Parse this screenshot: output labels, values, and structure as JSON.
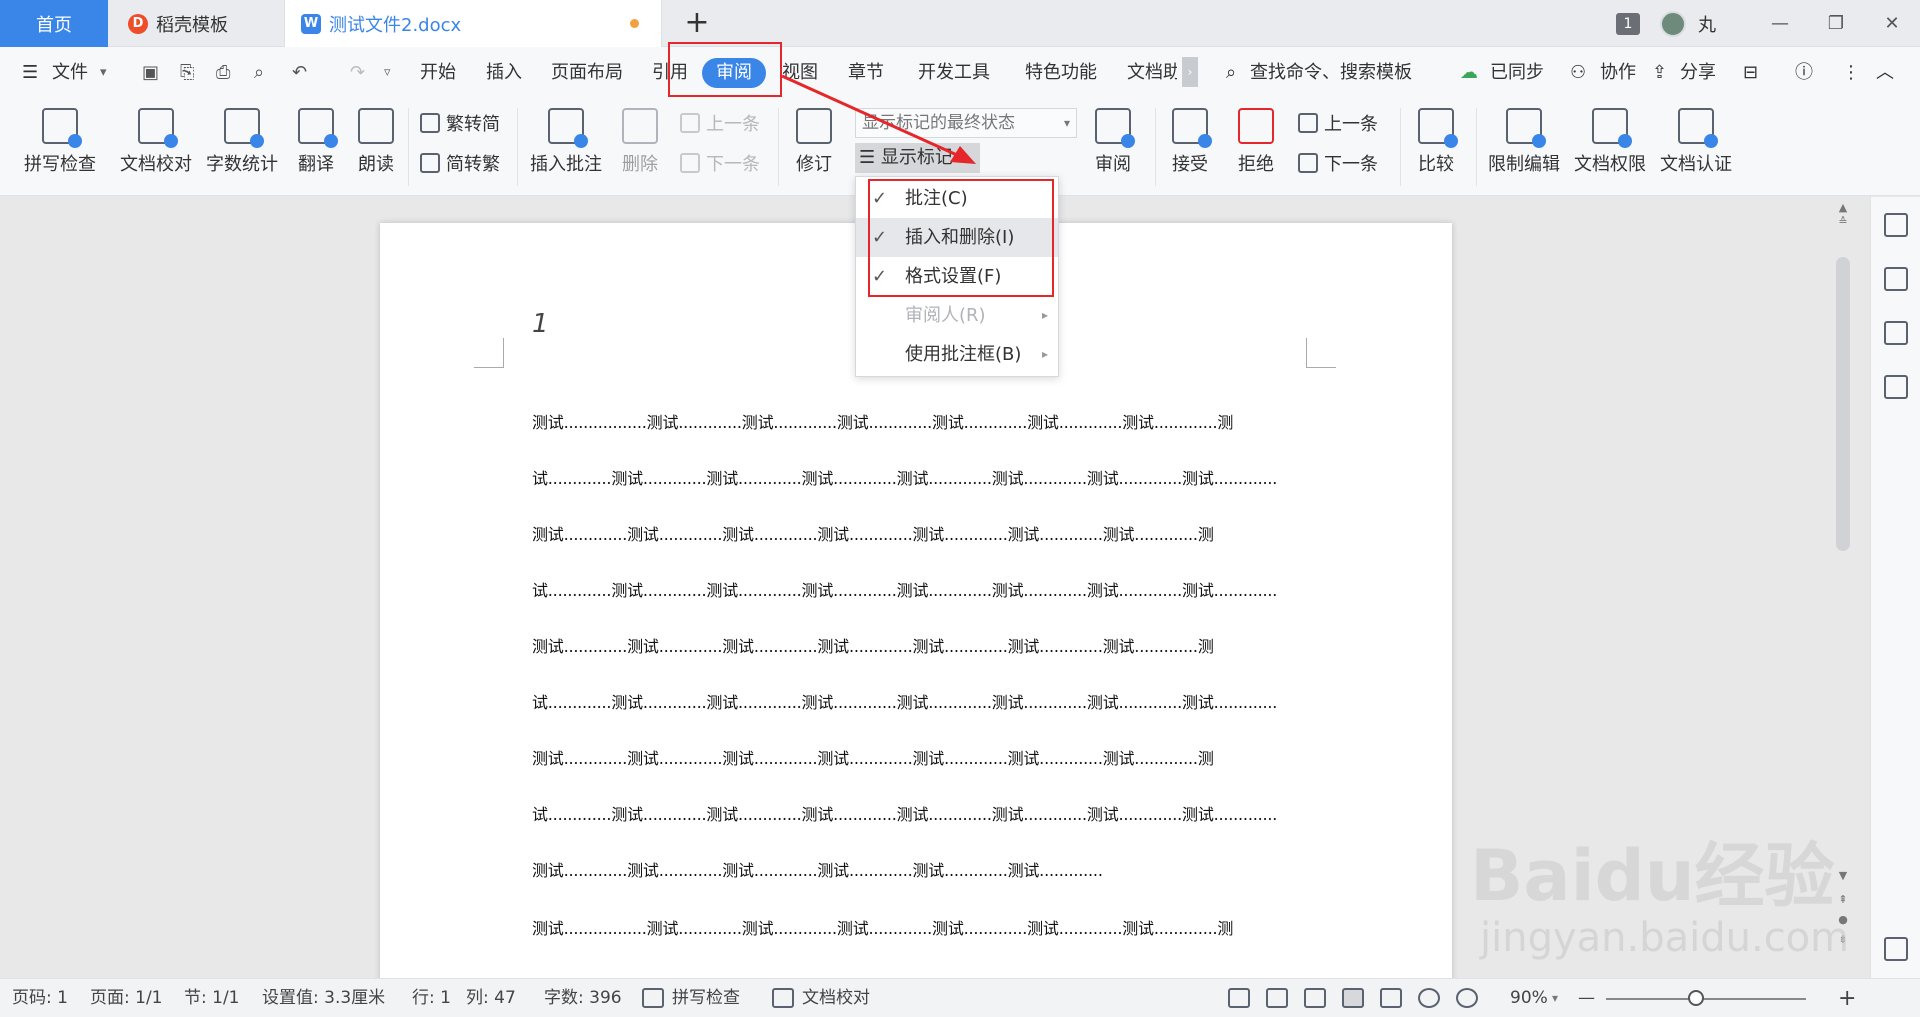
{
  "tabs": {
    "home": "首页",
    "daoke": "稻壳模板",
    "doc": "测试文件2.docx",
    "new_tab": "+"
  },
  "titlebar": {
    "window_count": "1",
    "username": "丸",
    "minimize": "—",
    "restore": "❐",
    "close": "✕"
  },
  "menu": {
    "file": "文件",
    "items": [
      "开始",
      "插入",
      "页面布局",
      "引用",
      "审阅",
      "视图",
      "章节",
      "开发工具",
      "特色功能",
      "文档助"
    ],
    "search": "查找命令、搜索模板",
    "synced": "已同步",
    "collab": "协作",
    "share": "分享"
  },
  "ribbon": {
    "spellcheck": "拼写检查",
    "proofread": "文档校对",
    "wordcount": "字数统计",
    "translate": "翻译",
    "read_aloud": "朗读",
    "trad_to_simp": "繁转简",
    "simp_to_trad": "简转繁",
    "insert_comment": "插入批注",
    "delete": "删除",
    "prev_comment": "上一条",
    "next_comment": "下一条",
    "track_changes": "修订",
    "markup_state": "显示标记的最终状态",
    "show_markup": "显示标记",
    "review": "审阅",
    "accept": "接受",
    "reject": "拒绝",
    "prev_change": "上一条",
    "next_change": "下一条",
    "compare": "比较",
    "restrict_edit": "限制编辑",
    "doc_permission": "文档权限",
    "doc_cert": "文档认证"
  },
  "dropdown": {
    "items": [
      {
        "label": "批注(C)",
        "checked": "✓"
      },
      {
        "label": "插入和删除(I)",
        "checked": "✓"
      },
      {
        "label": "格式设置(F)",
        "checked": "✓"
      },
      {
        "label": "审阅人(R)",
        "checked": ""
      },
      {
        "label": "使用批注框(B)",
        "checked": ""
      }
    ]
  },
  "document": {
    "page_number": "1",
    "lines": [
      "测试.................测试.............测试.............测试.............测试.............测试.............测试.............测",
      "试.............测试.............测试.............测试.............测试.............测试.............测试.............测试.............",
      "测试.............测试.............测试.............测试.............测试.............测试.............测试.............测",
      "试.............测试.............测试.............测试.............测试.............测试.............测试.............测试.............",
      "测试.............测试.............测试.............测试.............测试.............测试.............测试.............测",
      "试.............测试.............测试.............测试.............测试.............测试.............测试.............测试.............",
      "测试.............测试.............测试.............测试.............测试.............测试.............测试.............测",
      "试.............测试.............测试.............测试.............测试.............测试.............测试.............测试.............",
      "测试.............测试.............测试.............测试.............测试.............测试.............",
      "测试.................测试.............测试.............测试.............测试.............测试.............测试.............测"
    ]
  },
  "status": {
    "page_code": "页码: 1",
    "page": "页面: 1/1",
    "section": "节: 1/1",
    "setting": "设置值: 3.3厘米",
    "row": "行: 1",
    "col": "列: 47",
    "words": "字数: 396",
    "spellcheck": "拼写检查",
    "proofread": "文档校对",
    "zoom": "90%",
    "zoom_out": "—",
    "zoom_in": "+",
    "zoom_level": 0.45
  },
  "watermark": {
    "logo": "Baidu经验",
    "url": "jingyan.baidu.com"
  },
  "colors": {
    "accent": "#3a86e8",
    "annotation": "#e5262b"
  }
}
